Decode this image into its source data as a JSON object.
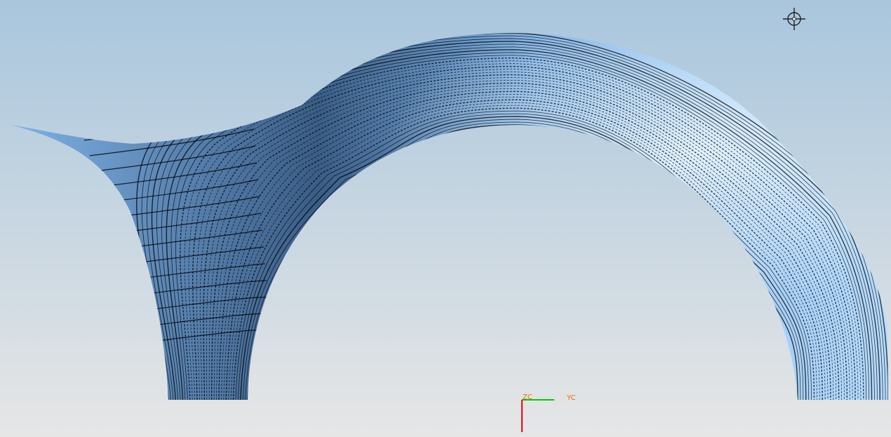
{
  "viewport": {
    "background_top_color": "#a9c6dd",
    "background_bottom_color": "#e6e6e6"
  },
  "model": {
    "surface_color": "#7fb2e5",
    "surface_highlight_color": "#b6dcff",
    "surface_shadow_color": "#3a5d86",
    "contour_line_color": "#000000"
  },
  "cursor": {
    "icon": "crosshair-icon"
  },
  "triad": {
    "z_label": "ZC",
    "y_label": "YC",
    "x_axis_color": "#ff0000",
    "y_axis_color": "#00cc00",
    "label_color": "#ff6600"
  }
}
